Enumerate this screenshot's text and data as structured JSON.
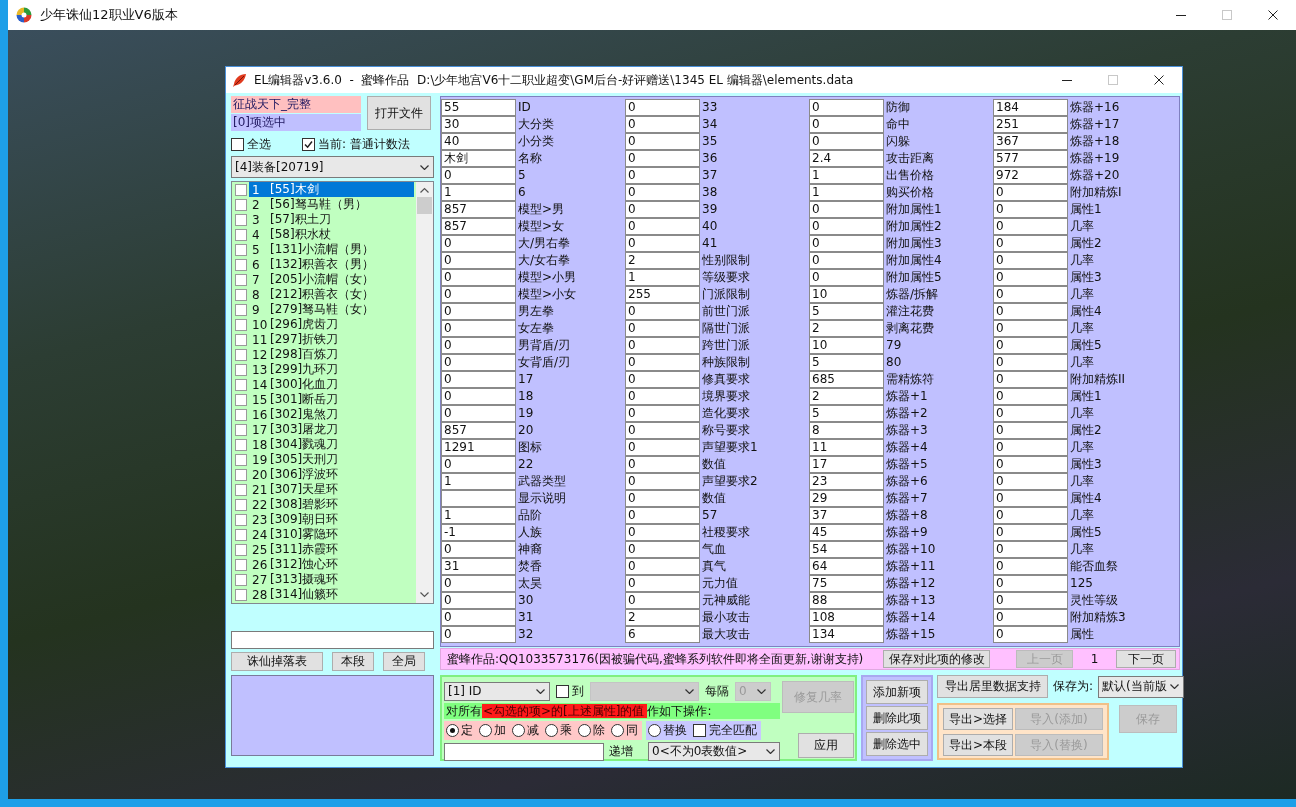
{
  "window": {
    "title": "少年诛仙12职业V6版本",
    "controls": [
      {
        "kind": "minimize",
        "disabled": false
      },
      {
        "kind": "maximize",
        "disabled": true
      },
      {
        "kind": "close",
        "disabled": false
      }
    ]
  },
  "editor": {
    "title": "EL编辑器v3.6.0  -  蜜蜂作品  D:\\少年地宫V6十二职业超变\\GM后台-好评赠送\\1345 EL 编辑器\\elements.data",
    "controls": [
      {
        "kind": "minimize",
        "disabled": false
      },
      {
        "kind": "maximize",
        "disabled": true
      },
      {
        "kind": "close",
        "disabled": false
      }
    ],
    "file_name": "征战天下_完整",
    "selection_count": "[0]项选中",
    "open_button": "打开文件",
    "select_all": {
      "label": "全选",
      "checked": false
    },
    "current_mode": {
      "label": "当前: 普通计数法",
      "checked": true
    },
    "category": "[4]装备[20719]",
    "items": [
      {
        "index": "1",
        "label": "[55]木剑",
        "checked": false,
        "selected": true
      },
      {
        "index": "2",
        "label": "[56]驽马鞋（男）",
        "checked": false,
        "selected": false
      },
      {
        "index": "3",
        "label": "[57]积土刀",
        "checked": false,
        "selected": false
      },
      {
        "index": "4",
        "label": "[58]积水杖",
        "checked": false,
        "selected": false
      },
      {
        "index": "5",
        "label": "[131]小流帽（男）",
        "checked": false,
        "selected": false
      },
      {
        "index": "6",
        "label": "[132]积善衣（男）",
        "checked": false,
        "selected": false
      },
      {
        "index": "7",
        "label": "[205]小流帽（女）",
        "checked": false,
        "selected": false
      },
      {
        "index": "8",
        "label": "[212]积善衣（女）",
        "checked": false,
        "selected": false
      },
      {
        "index": "9",
        "label": "[279]驽马鞋（女）",
        "checked": false,
        "selected": false
      },
      {
        "index": "10",
        "label": "[296]虎齿刀",
        "checked": false,
        "selected": false
      },
      {
        "index": "11",
        "label": "[297]折铁刀",
        "checked": false,
        "selected": false
      },
      {
        "index": "12",
        "label": "[298]百炼刀",
        "checked": false,
        "selected": false
      },
      {
        "index": "13",
        "label": "[299]九环刀",
        "checked": false,
        "selected": false
      },
      {
        "index": "14",
        "label": "[300]化血刀",
        "checked": false,
        "selected": false
      },
      {
        "index": "15",
        "label": "[301]断岳刀",
        "checked": false,
        "selected": false
      },
      {
        "index": "16",
        "label": "[302]鬼煞刀",
        "checked": false,
        "selected": false
      },
      {
        "index": "17",
        "label": "[303]屠龙刀",
        "checked": false,
        "selected": false
      },
      {
        "index": "18",
        "label": "[304]戮魂刀",
        "checked": false,
        "selected": false
      },
      {
        "index": "19",
        "label": "[305]天刑刀",
        "checked": false,
        "selected": false
      },
      {
        "index": "20",
        "label": "[306]浮波环",
        "checked": false,
        "selected": false
      },
      {
        "index": "21",
        "label": "[307]天星环",
        "checked": false,
        "selected": false
      },
      {
        "index": "22",
        "label": "[308]碧影环",
        "checked": false,
        "selected": false
      },
      {
        "index": "23",
        "label": "[309]朝日环",
        "checked": false,
        "selected": false
      },
      {
        "index": "24",
        "label": "[310]雾隐环",
        "checked": false,
        "selected": false
      },
      {
        "index": "25",
        "label": "[311]赤霞环",
        "checked": false,
        "selected": false
      },
      {
        "index": "26",
        "label": "[312]蚀心环",
        "checked": false,
        "selected": false
      },
      {
        "index": "27",
        "label": "[313]摄魂环",
        "checked": false,
        "selected": false
      },
      {
        "index": "28",
        "label": "[314]仙籁环",
        "checked": false,
        "selected": false
      }
    ],
    "drop_buttons": [
      "诛仙掉落表",
      "本段",
      "全局"
    ],
    "field_columns": [
      {
        "fields": [
          {
            "value": "55",
            "label": "ID"
          },
          {
            "value": "30",
            "label": "大分类"
          },
          {
            "value": "40",
            "label": "小分类"
          },
          {
            "value": "木剑",
            "label": "名称"
          },
          {
            "value": "0",
            "label": "5"
          },
          {
            "value": "1",
            "label": "6"
          },
          {
            "value": "857",
            "label": "模型>男"
          },
          {
            "value": "857",
            "label": "模型>女"
          },
          {
            "value": "0",
            "label": "大/男右拳"
          },
          {
            "value": "0",
            "label": "大/女右拳"
          },
          {
            "value": "0",
            "label": "模型>小男"
          },
          {
            "value": "0",
            "label": "模型>小女"
          },
          {
            "value": "0",
            "label": "男左拳"
          },
          {
            "value": "0",
            "label": "女左拳"
          },
          {
            "value": "0",
            "label": "男背盾/刃"
          },
          {
            "value": "0",
            "label": "女背盾/刃"
          },
          {
            "value": "0",
            "label": "17"
          },
          {
            "value": "0",
            "label": "18"
          },
          {
            "value": "0",
            "label": "19"
          },
          {
            "value": "857",
            "label": "20"
          },
          {
            "value": "1291",
            "label": "图标"
          },
          {
            "value": "0",
            "label": "22"
          },
          {
            "value": "1",
            "label": "武器类型"
          },
          {
            "label": "显示说明"
          },
          {
            "value": "1",
            "label": "品阶"
          },
          {
            "value": "-1",
            "label": "人族"
          },
          {
            "value": "0",
            "label": "神裔"
          },
          {
            "value": "31",
            "label": "焚香"
          },
          {
            "value": "0",
            "label": "太昊"
          },
          {
            "value": "0",
            "label": "30"
          },
          {
            "value": "0",
            "label": "31"
          },
          {
            "value": "0",
            "label": "32"
          }
        ]
      },
      {
        "fields": [
          {
            "value": "0",
            "label": "33"
          },
          {
            "value": "0",
            "label": "34"
          },
          {
            "value": "0",
            "label": "35"
          },
          {
            "value": "0",
            "label": "36"
          },
          {
            "value": "0",
            "label": "37"
          },
          {
            "value": "0",
            "label": "38"
          },
          {
            "value": "0",
            "label": "39"
          },
          {
            "value": "0",
            "label": "40"
          },
          {
            "value": "0",
            "label": "41"
          },
          {
            "value": "2",
            "label": "性别限制"
          },
          {
            "value": "1",
            "label": "等级要求"
          },
          {
            "value": "255",
            "label": "门派限制"
          },
          {
            "value": "0",
            "label": "前世门派"
          },
          {
            "value": "0",
            "label": "隔世门派"
          },
          {
            "value": "0",
            "label": "跨世门派"
          },
          {
            "value": "0",
            "label": "种族限制"
          },
          {
            "value": "0",
            "label": "修真要求"
          },
          {
            "value": "0",
            "label": "境界要求"
          },
          {
            "value": "0",
            "label": "造化要求"
          },
          {
            "value": "0",
            "label": "称号要求"
          },
          {
            "value": "0",
            "label": "声望要求1"
          },
          {
            "value": "0",
            "label": "数值"
          },
          {
            "value": "0",
            "label": "声望要求2"
          },
          {
            "value": "0",
            "label": "数值"
          },
          {
            "value": "0",
            "label": "57"
          },
          {
            "value": "0",
            "label": "社稷要求"
          },
          {
            "value": "0",
            "label": "气血"
          },
          {
            "value": "0",
            "label": "真气"
          },
          {
            "value": "0",
            "label": "元力值"
          },
          {
            "value": "0",
            "label": "元神威能"
          },
          {
            "value": "2",
            "label": "最小攻击"
          },
          {
            "value": "6",
            "label": "最大攻击"
          }
        ]
      },
      {
        "fields": [
          {
            "value": "0",
            "label": "防御"
          },
          {
            "value": "0",
            "label": "命中"
          },
          {
            "value": "0",
            "label": "闪躲"
          },
          {
            "value": "2.4",
            "label": "攻击距离"
          },
          {
            "value": "1",
            "label": "出售价格"
          },
          {
            "value": "1",
            "label": "购买价格"
          },
          {
            "value": "0",
            "label": "附加属性1"
          },
          {
            "value": "0",
            "label": "附加属性2"
          },
          {
            "value": "0",
            "label": "附加属性3"
          },
          {
            "value": "0",
            "label": "附加属性4"
          },
          {
            "value": "0",
            "label": "附加属性5"
          },
          {
            "value": "10",
            "label": "炼器/拆解"
          },
          {
            "value": "5",
            "label": "灌注花费"
          },
          {
            "value": "2",
            "label": "剥离花费"
          },
          {
            "value": "10",
            "label": "79"
          },
          {
            "value": "5",
            "label": "80"
          },
          {
            "value": "685",
            "label": "需精炼符"
          },
          {
            "value": "2",
            "label": "炼器+1"
          },
          {
            "value": "5",
            "label": "炼器+2"
          },
          {
            "value": "8",
            "label": "炼器+3"
          },
          {
            "value": "11",
            "label": "炼器+4"
          },
          {
            "value": "17",
            "label": "炼器+5"
          },
          {
            "value": "23",
            "label": "炼器+6"
          },
          {
            "value": "29",
            "label": "炼器+7"
          },
          {
            "value": "37",
            "label": "炼器+8"
          },
          {
            "value": "45",
            "label": "炼器+9"
          },
          {
            "value": "54",
            "label": "炼器+10"
          },
          {
            "value": "64",
            "label": "炼器+11"
          },
          {
            "value": "75",
            "label": "炼器+12"
          },
          {
            "value": "88",
            "label": "炼器+13"
          },
          {
            "value": "108",
            "label": "炼器+14"
          },
          {
            "value": "134",
            "label": "炼器+15"
          }
        ]
      },
      {
        "fields": [
          {
            "value": "184",
            "label": "炼器+16"
          },
          {
            "value": "251",
            "label": "炼器+17"
          },
          {
            "value": "367",
            "label": "炼器+18"
          },
          {
            "value": "577",
            "label": "炼器+19"
          },
          {
            "value": "972",
            "label": "炼器+20"
          },
          {
            "value": "0",
            "label": "附加精炼I"
          },
          {
            "value": "0",
            "label": "属性1"
          },
          {
            "value": "0",
            "label": "几率"
          },
          {
            "value": "0",
            "label": "属性2"
          },
          {
            "value": "0",
            "label": "几率"
          },
          {
            "value": "0",
            "label": "属性3"
          },
          {
            "value": "0",
            "label": "几率"
          },
          {
            "value": "0",
            "label": "属性4"
          },
          {
            "value": "0",
            "label": "几率"
          },
          {
            "value": "0",
            "label": "属性5"
          },
          {
            "value": "0",
            "label": "几率"
          },
          {
            "value": "0",
            "label": "附加精炼II"
          },
          {
            "value": "0",
            "label": "属性1"
          },
          {
            "value": "0",
            "label": "几率"
          },
          {
            "value": "0",
            "label": "属性2"
          },
          {
            "value": "0",
            "label": "几率"
          },
          {
            "value": "0",
            "label": "属性3"
          },
          {
            "value": "0",
            "label": "几率"
          },
          {
            "value": "0",
            "label": "属性4"
          },
          {
            "value": "0",
            "label": "几率"
          },
          {
            "value": "0",
            "label": "属性5"
          },
          {
            "value": "0",
            "label": "几率"
          },
          {
            "value": "0",
            "label": "能否血祭"
          },
          {
            "value": "0",
            "label": "125"
          },
          {
            "value": "0",
            "label": "灵性等级"
          },
          {
            "value": "0",
            "label": "附加精炼3"
          },
          {
            "value": "0",
            "label": "属性"
          }
        ]
      }
    ],
    "notice": "蜜蜂作品:QQ1033573176(因被骗代码,蜜蜂系列软件即将全面更新,谢谢支持)",
    "save_changes_button": "保存对此项的修改",
    "prev_button": {
      "label": "上一页",
      "disabled": true
    },
    "page": "1",
    "next_button": {
      "label": "下一页",
      "disabled": false
    },
    "batch": {
      "field_select": "[1] ID",
      "range_to": {
        "label": "到",
        "checked": false
      },
      "range_select": {
        "disabled": true
      },
      "interval_label": "每隔",
      "interval_select": {
        "value": "0",
        "disabled": true
      },
      "fix_button": {
        "label": "修复几率",
        "disabled": true
      },
      "instruction": [
        {
          "text": "对所有",
          "highlighted": false
        },
        {
          "text": "<勾选的项>的[上述属性]的值",
          "highlighted": true
        },
        {
          "text": "作如下操作:",
          "highlighted": false
        }
      ],
      "operations": [
        {
          "label": "定",
          "kind": "numeric",
          "selected": true
        },
        {
          "label": "加",
          "kind": "numeric",
          "selected": false
        },
        {
          "label": "减",
          "kind": "numeric",
          "selected": false
        },
        {
          "label": "乘",
          "kind": "numeric",
          "selected": false
        },
        {
          "label": "除",
          "kind": "numeric",
          "selected": false
        },
        {
          "label": "同",
          "kind": "numeric",
          "selected": false
        },
        {
          "label": "替换",
          "kind": "text",
          "selected": false
        }
      ],
      "exact_match": {
        "label": "完全匹配",
        "checked": false
      },
      "increment_label": "递增",
      "mode_select": "0<不为0表数值>",
      "apply_button": "应用"
    },
    "item_buttons": [
      "添加新项",
      "删除此项",
      "删除选中"
    ],
    "export_button": "导出居里数据支持",
    "save_as_label": "保存为:",
    "save_as_select": "默认(当前版",
    "io_buttons": [
      {
        "label": "导出>选择",
        "disabled": false
      },
      {
        "label": "导入(添加)",
        "disabled": true
      },
      {
        "label": "导出>本段",
        "disabled": false
      },
      {
        "label": "导入(替换)",
        "disabled": true
      }
    ],
    "save_button": {
      "label": "保存",
      "disabled": true
    }
  }
}
